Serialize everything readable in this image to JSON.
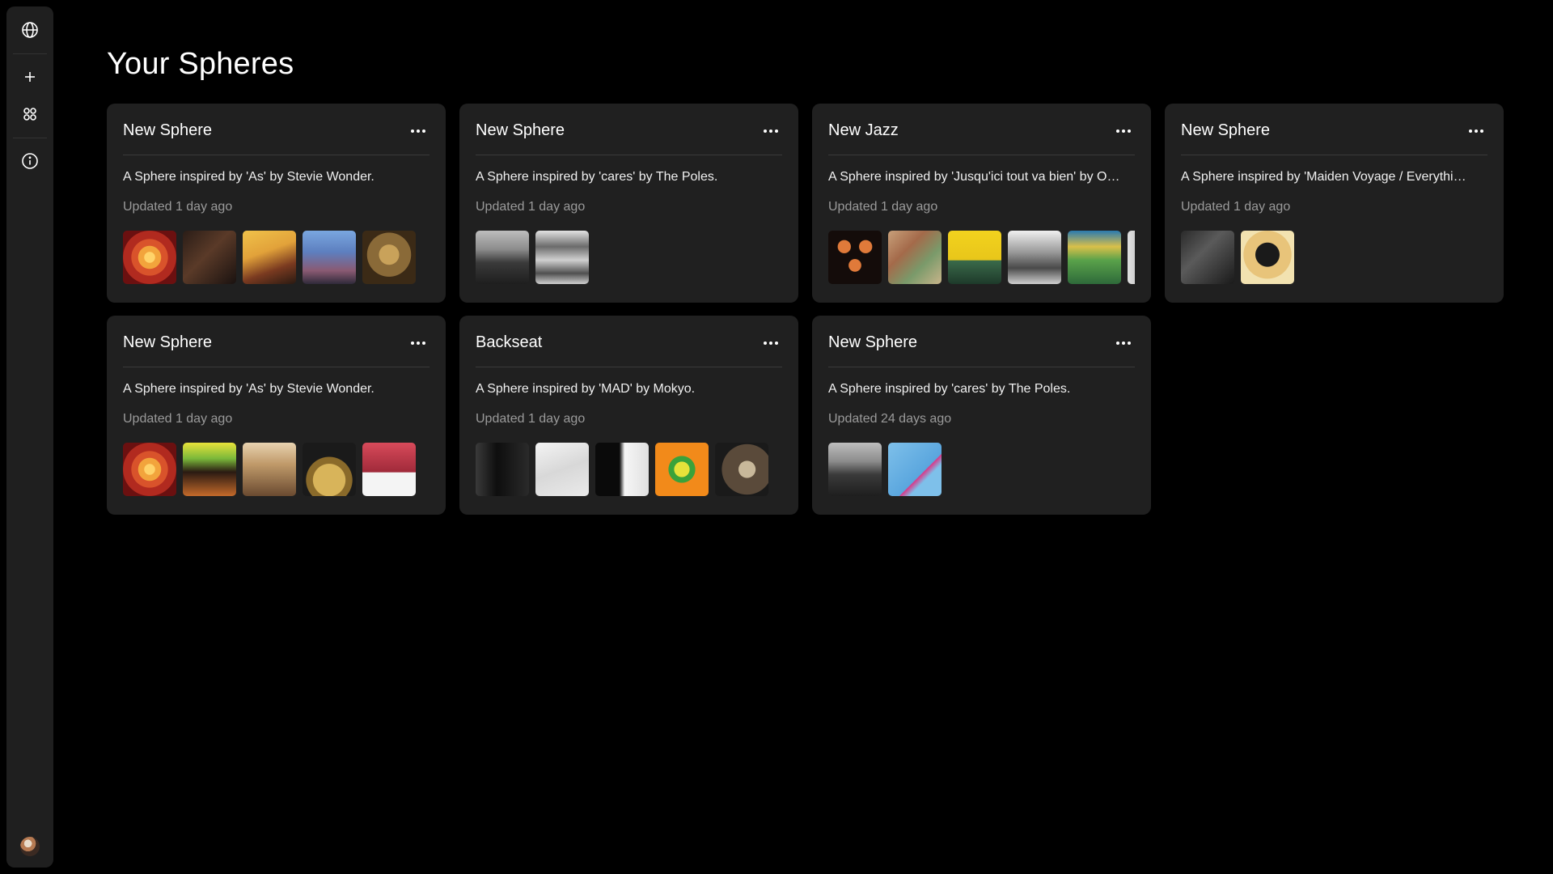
{
  "sidebar": {
    "items": [
      {
        "icon": "globe-icon"
      },
      {
        "icon": "plus-icon"
      },
      {
        "icon": "grid-icon"
      },
      {
        "icon": "info-icon"
      }
    ],
    "avatar": "avatar"
  },
  "page": {
    "title": "Your Spheres"
  },
  "cards": [
    {
      "title": "New Sphere",
      "description": "A Sphere inspired by 'As' by Stevie Wonder.",
      "updated": "Updated 1 day ago",
      "covers": [
        {
          "name": "album-cover-1",
          "bg": "radial-gradient(circle,#ffd36a 0 14%,#f2a43c 15% 30%,#d9532b 31% 48%,#b12a1f 49% 70%,#6b1010 71%)"
        },
        {
          "name": "album-cover-2",
          "bg": "linear-gradient(135deg,#2a1d17 0%,#5a3a28 45%,#1a1210 100%)"
        },
        {
          "name": "album-cover-3",
          "bg": "linear-gradient(160deg,#f0c24a 0%,#e2a23a 40%,#7a3a20 70%,#2a1a12 100%)"
        },
        {
          "name": "album-cover-4",
          "bg": "linear-gradient(180deg,#7aa7e0 0%,#5d7fbf 40%,#8a5a72 75%,#2f2a3a 100%)"
        },
        {
          "name": "album-cover-5",
          "bg": "radial-gradient(circle at 50% 45%,#c9a25a 0 25%,#8a6a38 26% 55%,#3b2a16 56%)"
        }
      ]
    },
    {
      "title": "New Sphere",
      "description": "A Sphere inspired by 'cares' by The Poles.",
      "updated": "Updated 1 day ago",
      "covers": [
        {
          "name": "album-cover-1",
          "bg": "linear-gradient(180deg,#bdbdbd 0%,#8c8c8c 35%,#3a3a3a 60%,#1e1e1e 100%)"
        },
        {
          "name": "album-cover-2",
          "bg": "linear-gradient(180deg,#e2e2e2 0%,#6b6b6b 30%,#d0d0d0 55%,#505050 80%,#cfcfcf 100%)"
        }
      ]
    },
    {
      "title": "New Jazz",
      "description": "A Sphere inspired by 'Jusqu'ici tout va bien' by O…",
      "updated": "Updated 1 day ago",
      "covers": [
        {
          "name": "album-cover-1",
          "bg": "radial-gradient(circle at 30% 30%,#e07a3a 0 12%,transparent 13%),radial-gradient(circle at 70% 30%,#e07a3a 0 12%,transparent 13%),radial-gradient(circle at 50% 65%,#e07a3a 0 14%,transparent 15%),#140c0a"
        },
        {
          "name": "album-cover-2",
          "bg": "linear-gradient(135deg,#c8a07a 0%,#a46a4a 35%,#7a9a6a 65%,#c8b48a 100%)"
        },
        {
          "name": "album-cover-3",
          "bg": "linear-gradient(180deg,#f2d21e 0%,#e8c61a 55%,#3a6a4a 56%,#1e3a2a 100%)"
        },
        {
          "name": "album-cover-4",
          "bg": "linear-gradient(180deg,#f0f0f0 0%,#9a9a9a 40%,#4a4a4a 70%,#cfcfcf 100%)"
        },
        {
          "name": "album-cover-5",
          "bg": "linear-gradient(180deg,#2a7ab0 0%,#d9c04a 30%,#5aa24a 55%,#2e6a3a 100%)"
        },
        {
          "name": "album-cover-6",
          "bg": "linear-gradient(90deg,#e0e0e0 0%,#6a6a6a 100%)"
        }
      ]
    },
    {
      "title": "New Sphere",
      "description": "A Sphere inspired by 'Maiden Voyage / Everythi…",
      "updated": "Updated 1 day ago",
      "covers": [
        {
          "name": "album-cover-1",
          "bg": "linear-gradient(135deg,#2a2a2a 0%,#5a5a5a 40%,#1a1a1a 100%)"
        },
        {
          "name": "album-cover-2",
          "bg": "radial-gradient(circle at 50% 45%,#1a1a1a 0 30%,#e8c47a 31% 60%,#f2e2b0 61%)"
        }
      ]
    },
    {
      "title": "New Sphere",
      "description": "A Sphere inspired by 'As' by Stevie Wonder.",
      "updated": "Updated 1 day ago",
      "covers": [
        {
          "name": "album-cover-1",
          "bg": "radial-gradient(circle,#ffd36a 0 14%,#f2a43c 15% 30%,#d9532b 31% 48%,#b12a1f 49% 70%,#6b1010 71%)"
        },
        {
          "name": "album-cover-2",
          "bg": "linear-gradient(180deg,#e8e23a 0%,#7ab83a 30%,#2a1a12 55%,#c46a2a 100%)"
        },
        {
          "name": "album-cover-3",
          "bg": "linear-gradient(180deg,#e8d2b0 0%,#c09a6a 40%,#6a4a30 100%)"
        },
        {
          "name": "album-cover-4",
          "bg": "radial-gradient(circle at 50% 70%,#d8b45a 0 35%,#8a6a2a 36% 50%,#1a1a1a 51%)"
        },
        {
          "name": "album-cover-5",
          "bg": "linear-gradient(180deg,#d84a5a 0%,#a02a3a 55%,#f4f4f4 56%)"
        }
      ]
    },
    {
      "title": "Backseat",
      "description": "A Sphere inspired by 'MAD' by Mokyo.",
      "updated": "Updated 1 day ago",
      "covers": [
        {
          "name": "album-cover-1",
          "bg": "linear-gradient(90deg,#3a3a3a 0%,#0e0e0e 40%,#2a2a2a 100%)"
        },
        {
          "name": "album-cover-2",
          "bg": "linear-gradient(160deg,#f4f4f4 0%,#d8d8d8 50%,#eaeaea 100%)"
        },
        {
          "name": "album-cover-3",
          "bg": "linear-gradient(90deg,#0a0a0a 0%,#0a0a0a 45%,#f6f6f6 55%,#e0e0e0 100%)"
        },
        {
          "name": "album-cover-4",
          "bg": "radial-gradient(circle at 50% 50%,#e6e23a 0 20%,#3aa23a 21% 35%,#f28a1a 36%)"
        },
        {
          "name": "album-cover-5",
          "bg": "radial-gradient(circle at 60% 50%,#c8b89a 0 20%,#5a4a3a 21% 60%,#1a1a1a 61%)"
        }
      ]
    },
    {
      "title": "New Sphere",
      "description": "A Sphere inspired by 'cares' by The Poles.",
      "updated": "Updated 24 days ago",
      "covers": [
        {
          "name": "album-cover-1",
          "bg": "linear-gradient(180deg,#bdbdbd 0%,#8c8c8c 35%,#3a3a3a 60%,#1e1e1e 100%)"
        },
        {
          "name": "album-cover-2",
          "bg": "linear-gradient(135deg,#7ec0ea 0%,#5aa6de 60%,#d83a8a 61%,#7ec0ea 70%)"
        }
      ]
    }
  ]
}
